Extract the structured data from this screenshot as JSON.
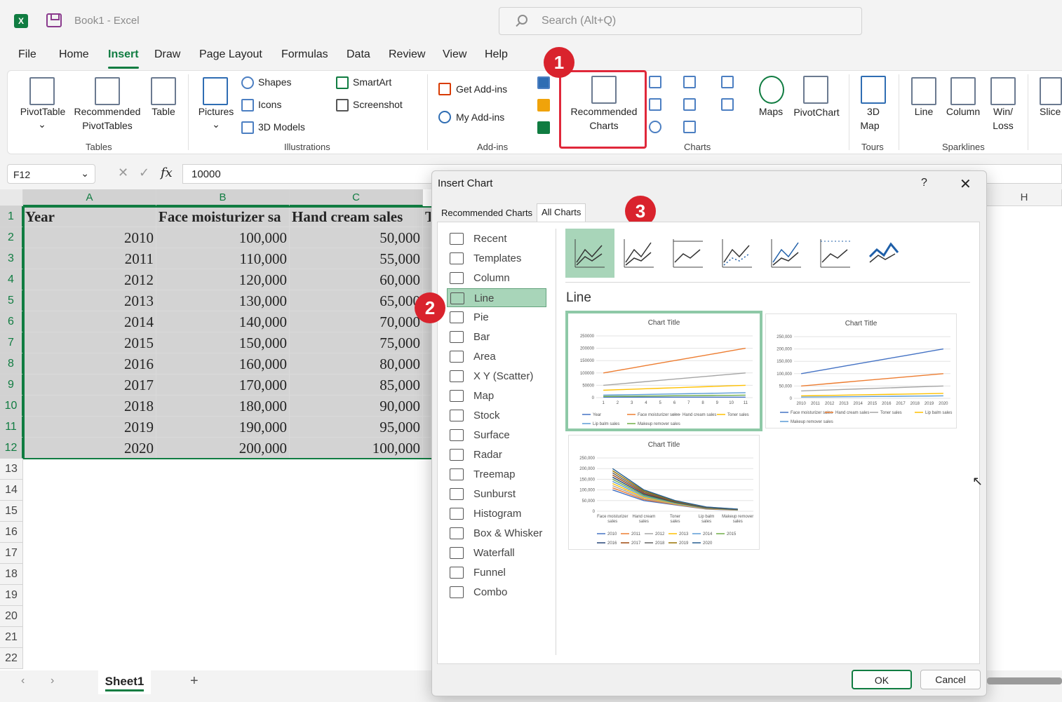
{
  "app": {
    "title": "Book1  -  Excel",
    "search_placeholder": "Search (Alt+Q)"
  },
  "menu": [
    "File",
    "Home",
    "Insert",
    "Draw",
    "Page Layout",
    "Formulas",
    "Data",
    "Review",
    "View",
    "Help"
  ],
  "ribbon": {
    "tables": {
      "label": "Tables",
      "pivottable": "PivotTable",
      "recommended_pivot_line1": "Recommended",
      "recommended_pivot_line2": "PivotTables",
      "table": "Table"
    },
    "illustrations": {
      "label": "Illustrations",
      "pictures": "Pictures",
      "shapes": "Shapes",
      "icons": "Icons",
      "models3d": "3D Models",
      "smartart": "SmartArt",
      "screenshot": "Screenshot"
    },
    "addins": {
      "label": "Add-ins",
      "get": "Get Add-ins",
      "my": "My Add-ins"
    },
    "charts": {
      "label": "Charts",
      "recommended_line1": "Recommended",
      "recommended_line2": "Charts",
      "maps": "Maps",
      "pivotchart": "PivotChart"
    },
    "tours": {
      "label": "Tours",
      "map3d_line1": "3D",
      "map3d_line2": "Map"
    },
    "sparklines": {
      "label": "Sparklines",
      "line": "Line",
      "column": "Column",
      "winloss_line1": "Win/",
      "winloss_line2": "Loss"
    },
    "slicer": "Slice"
  },
  "badges": [
    "1",
    "2",
    "3"
  ],
  "formula": {
    "namebox": "F12",
    "value": "10000"
  },
  "columns": [
    "A",
    "B",
    "C",
    "H"
  ],
  "rows": [
    "1",
    "2",
    "3",
    "4",
    "5",
    "6",
    "7",
    "8",
    "9",
    "10",
    "11",
    "12",
    "13",
    "14",
    "15",
    "16",
    "17",
    "18",
    "19",
    "20",
    "21",
    "22"
  ],
  "table": {
    "headers": [
      "Year",
      "Face moisturizer sa",
      "Hand cream sales",
      "T"
    ],
    "data": [
      [
        "2010",
        "100,000",
        "50,000"
      ],
      [
        "2011",
        "110,000",
        "55,000"
      ],
      [
        "2012",
        "120,000",
        "60,000"
      ],
      [
        "2013",
        "130,000",
        "65,000"
      ],
      [
        "2014",
        "140,000",
        "70,000"
      ],
      [
        "2015",
        "150,000",
        "75,000"
      ],
      [
        "2016",
        "160,000",
        "80,000"
      ],
      [
        "2017",
        "170,000",
        "85,000"
      ],
      [
        "2018",
        "180,000",
        "90,000"
      ],
      [
        "2019",
        "190,000",
        "95,000"
      ],
      [
        "2020",
        "200,000",
        "100,000"
      ]
    ]
  },
  "sheet": {
    "tab": "Sheet1",
    "add": "+"
  },
  "dialog": {
    "title": "Insert Chart",
    "help": "?",
    "tabs": [
      "Recommended Charts",
      "All Charts"
    ],
    "categories": [
      "Recent",
      "Templates",
      "Column",
      "Line",
      "Pie",
      "Bar",
      "Area",
      "X Y (Scatter)",
      "Map",
      "Stock",
      "Surface",
      "Radar",
      "Treemap",
      "Sunburst",
      "Histogram",
      "Box & Whisker",
      "Waterfall",
      "Funnel",
      "Combo"
    ],
    "selected_category": "Line",
    "section_title": "Line",
    "ok": "OK",
    "cancel": "Cancel"
  },
  "chart_data": [
    {
      "type": "line",
      "title": "Chart Title",
      "x": [
        "1",
        "2",
        "3",
        "4",
        "5",
        "6",
        "7",
        "8",
        "9",
        "10",
        "11"
      ],
      "ylim": [
        0,
        250000
      ],
      "yticks": [
        "250000",
        "200000",
        "150000",
        "100000",
        "50000",
        "0"
      ],
      "series": [
        {
          "name": "Year",
          "values": [
            2010,
            2011,
            2012,
            2013,
            2014,
            2015,
            2016,
            2017,
            2018,
            2019,
            2020
          ]
        },
        {
          "name": "Face moisturizer sales",
          "values": [
            100000,
            110000,
            120000,
            130000,
            140000,
            150000,
            160000,
            170000,
            180000,
            190000,
            200000
          ]
        },
        {
          "name": "Hand cream sales",
          "values": [
            50000,
            55000,
            60000,
            65000,
            70000,
            75000,
            80000,
            85000,
            90000,
            95000,
            100000
          ]
        },
        {
          "name": "Toner sales",
          "values": [
            30000,
            32000,
            34000,
            36000,
            38000,
            40000,
            42000,
            44000,
            46000,
            48000,
            50000
          ]
        },
        {
          "name": "Lip balm sales",
          "values": [
            10000,
            11000,
            12000,
            13000,
            14000,
            15000,
            16000,
            17000,
            18000,
            19000,
            20000
          ]
        },
        {
          "name": "Makeup remover sales",
          "values": [
            5000,
            5500,
            6000,
            6500,
            7000,
            7500,
            8000,
            8500,
            9000,
            9500,
            10000
          ]
        }
      ],
      "colors": [
        "#4472c4",
        "#ed7d31",
        "#a5a5a5",
        "#ffc000",
        "#5b9bd5",
        "#70ad47"
      ]
    },
    {
      "type": "line",
      "title": "Chart Title",
      "x": [
        "2010",
        "2011",
        "2012",
        "2013",
        "2014",
        "2015",
        "2016",
        "2017",
        "2018",
        "2019",
        "2020"
      ],
      "ylim": [
        0,
        250000
      ],
      "yticks": [
        "250,000",
        "200,000",
        "150,000",
        "100,000",
        "50,000",
        "0"
      ],
      "series": [
        {
          "name": "Face moisturizer sales",
          "values": [
            100000,
            110000,
            120000,
            130000,
            140000,
            150000,
            160000,
            170000,
            180000,
            190000,
            200000
          ]
        },
        {
          "name": "Hand cream sales",
          "values": [
            50000,
            55000,
            60000,
            65000,
            70000,
            75000,
            80000,
            85000,
            90000,
            95000,
            100000
          ]
        },
        {
          "name": "Toner sales",
          "values": [
            30000,
            32000,
            34000,
            36000,
            38000,
            40000,
            42000,
            44000,
            46000,
            48000,
            50000
          ]
        },
        {
          "name": "Lip balm sales",
          "values": [
            10000,
            11000,
            12000,
            13000,
            14000,
            15000,
            16000,
            17000,
            18000,
            19000,
            20000
          ]
        },
        {
          "name": "Makeup remover sales",
          "values": [
            5000,
            5500,
            6000,
            6500,
            7000,
            7500,
            8000,
            8500,
            9000,
            9500,
            10000
          ]
        }
      ],
      "colors": [
        "#4472c4",
        "#ed7d31",
        "#a5a5a5",
        "#ffc000",
        "#5b9bd5"
      ]
    },
    {
      "type": "line",
      "title": "Chart Title",
      "x": [
        "Face moisturizer sales",
        "Hand cream sales",
        "Toner sales",
        "Lip balm sales",
        "Makeup remover sales"
      ],
      "ylim": [
        0,
        250000
      ],
      "yticks": [
        "250,000",
        "200,000",
        "150,000",
        "100,000",
        "50,000",
        "0"
      ],
      "series": [
        {
          "name": "2010",
          "values": [
            100000,
            50000,
            30000,
            10000,
            5000
          ]
        },
        {
          "name": "2011",
          "values": [
            110000,
            55000,
            32000,
            11000,
            5500
          ]
        },
        {
          "name": "2012",
          "values": [
            120000,
            60000,
            34000,
            12000,
            6000
          ]
        },
        {
          "name": "2013",
          "values": [
            130000,
            65000,
            36000,
            13000,
            6500
          ]
        },
        {
          "name": "2014",
          "values": [
            140000,
            70000,
            38000,
            14000,
            7000
          ]
        },
        {
          "name": "2015",
          "values": [
            150000,
            75000,
            40000,
            15000,
            7500
          ]
        },
        {
          "name": "2016",
          "values": [
            160000,
            80000,
            42000,
            16000,
            8000
          ]
        },
        {
          "name": "2017",
          "values": [
            170000,
            85000,
            44000,
            17000,
            8500
          ]
        },
        {
          "name": "2018",
          "values": [
            180000,
            90000,
            46000,
            18000,
            9000
          ]
        },
        {
          "name": "2019",
          "values": [
            190000,
            95000,
            48000,
            19000,
            9500
          ]
        },
        {
          "name": "2020",
          "values": [
            200000,
            100000,
            50000,
            20000,
            10000
          ]
        }
      ],
      "colors": [
        "#4472c4",
        "#ed7d31",
        "#a5a5a5",
        "#ffc000",
        "#5b9bd5",
        "#70ad47",
        "#264478",
        "#9e480e",
        "#636363",
        "#997300",
        "#255e91"
      ]
    }
  ]
}
